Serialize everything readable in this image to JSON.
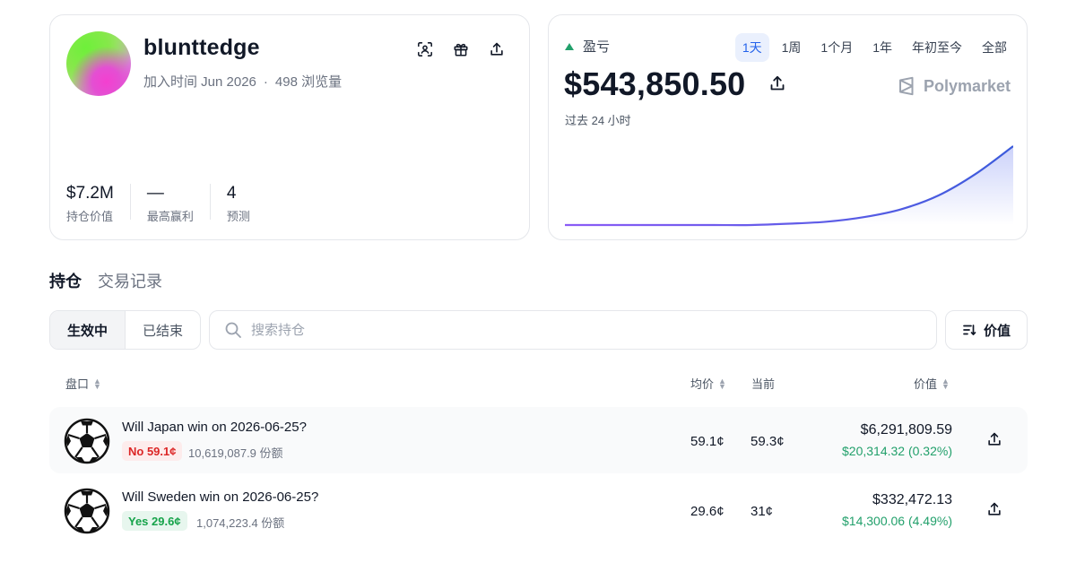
{
  "profile": {
    "username": "blunttedge",
    "joined": "加入时间 Jun 2026",
    "separator": "·",
    "views": "498 浏览量",
    "stats": [
      {
        "value": "$7.2M",
        "label": "持仓价值"
      },
      {
        "value": "—",
        "label": "最高赢利"
      },
      {
        "value": "4",
        "label": "预测"
      }
    ]
  },
  "pnl": {
    "label": "盈亏",
    "value": "$543,850.50",
    "subtitle": "过去 24 小时",
    "brand": "Polymarket",
    "ranges": [
      "1天",
      "1周",
      "1个月",
      "1年",
      "年初至今",
      "全部"
    ],
    "active_range": "1天"
  },
  "chart_data": {
    "type": "area",
    "title": "",
    "xlabel": "",
    "ylabel": "",
    "x": [
      0,
      1,
      2,
      3,
      4,
      5,
      6,
      7,
      8,
      9,
      10,
      11,
      12
    ],
    "values": [
      0,
      0,
      0,
      0,
      0,
      0,
      2,
      5,
      12,
      24,
      45,
      78,
      120
    ],
    "grid": false,
    "legend": "none"
  },
  "tabs": [
    "持仓",
    "交易记录"
  ],
  "filters": {
    "segments": [
      "生效中",
      "已结束"
    ],
    "search_placeholder": "搜索持仓",
    "sort_label": "价值"
  },
  "table": {
    "headers": {
      "market": "盘口",
      "avg": "均价",
      "current": "当前",
      "value": "价值"
    },
    "rows": [
      {
        "title": "Will Japan win on 2026-06-25?",
        "outcome": "No 59.1¢",
        "outcome_type": "no",
        "shares": "10,619,087.9 份额",
        "avg": "59.1¢",
        "current": "59.3¢",
        "value": "$6,291,809.59",
        "change": "$20,314.32 (0.32%)"
      },
      {
        "title": "Will Sweden win on 2026-06-25?",
        "outcome": "Yes 29.6¢",
        "outcome_type": "yes",
        "shares": "1,074,223.4 份额",
        "avg": "29.6¢",
        "current": "31¢",
        "value": "$332,472.13",
        "change": "$14,300.06 (4.49%)"
      }
    ]
  },
  "colors": {
    "accent_blue": "#2563eb",
    "gain_green": "#22a06b",
    "loss_red": "#dc2626",
    "chart_line_start": "#8b5cf6",
    "chart_line_end": "#3b5bdb"
  }
}
